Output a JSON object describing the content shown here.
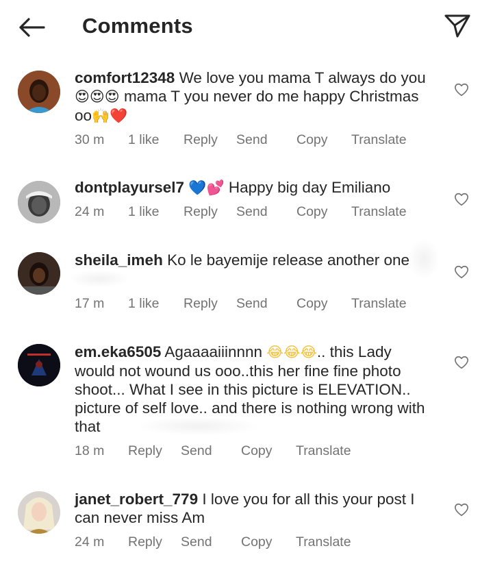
{
  "header": {
    "title": "Comments",
    "back_icon": "arrow-left-icon",
    "send_icon": "paper-plane-icon"
  },
  "colors": {
    "text": "#262626",
    "meta": "#737373",
    "heart_emoji": "#e0245e",
    "blue_heart": "#2b8be6",
    "pink_hearts": "#e8458b",
    "laugh_emoji": "#f5c03b"
  },
  "comments": [
    {
      "username": "comfort12348",
      "text_parts": [
        "We love you mama T always do you",
        "😍😍😍",
        " mama T you never do me happy Christmas oo",
        "🙌",
        "❤️"
      ],
      "time": "30 m",
      "likes": "1 like",
      "actions": [
        "Reply",
        "Send",
        "Copy",
        "Translate"
      ]
    },
    {
      "username": "dontplayursel7",
      "text_parts": [
        "💙💕",
        " Happy big day Emiliano"
      ],
      "time": "24 m",
      "likes": "1 like",
      "actions": [
        "Reply",
        "Send",
        "Copy",
        "Translate"
      ]
    },
    {
      "username": "sheila_imeh",
      "text_parts": [
        "Ko le bayemije release another one"
      ],
      "time": "17 m",
      "likes": "1 like",
      "actions": [
        "Reply",
        "Send",
        "Copy",
        "Translate"
      ]
    },
    {
      "username": "em.eka6505",
      "text_parts": [
        "Agaaaaiiinnnn ",
        "😂😂😂",
        ".. this Lady would not wound us ooo..this her fine fine photo shoot... What I see in this picture is ELEVATION.. picture of self love.. and there is nothing wrong with that"
      ],
      "time": "18 m",
      "likes": "",
      "actions": [
        "Reply",
        "Send",
        "Copy",
        "Translate"
      ]
    },
    {
      "username": "janet_robert_779",
      "text_parts": [
        "I love you for all this your post I can never miss  Am"
      ],
      "time": "24 m",
      "likes": "",
      "actions": [
        "Reply",
        "Send",
        "Copy",
        "Translate"
      ]
    }
  ]
}
